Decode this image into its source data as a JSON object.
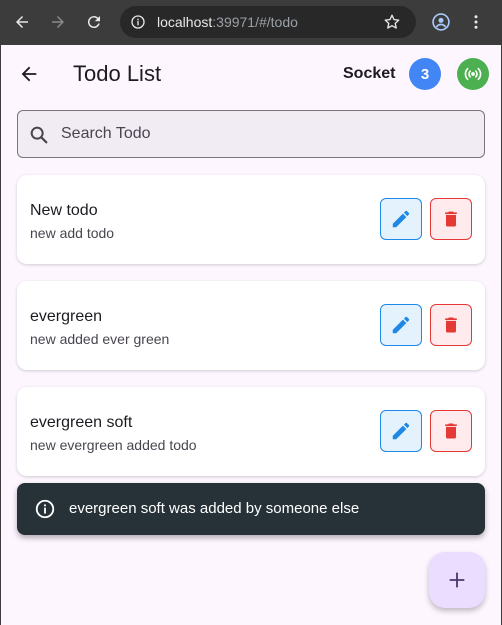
{
  "browser": {
    "url_host": "localhost",
    "url_rest": ":39971/#/todo"
  },
  "appbar": {
    "title": "Todo List",
    "socket_label": "Socket",
    "connected_count": "3"
  },
  "search": {
    "placeholder": "Search Todo",
    "value": ""
  },
  "todos": [
    {
      "title": "New todo",
      "description": "new add todo"
    },
    {
      "title": "evergreen",
      "description": "new added ever green"
    },
    {
      "title": "evergreen soft",
      "description": "new evergreen added todo"
    }
  ],
  "snackbar": {
    "message": "evergreen soft was added by someone else"
  },
  "colors": {
    "accent_blue": "#4285f4",
    "socket_connected": "#4caf50",
    "edit": "#1e88e5",
    "delete": "#e53935",
    "fab_bg": "#eaddff"
  },
  "icons": {
    "back": "arrow-back-icon",
    "status": "wifi-tethering-icon",
    "search": "search-icon",
    "edit": "pencil-icon",
    "delete": "trash-icon",
    "info": "info-icon",
    "add": "plus-icon"
  }
}
